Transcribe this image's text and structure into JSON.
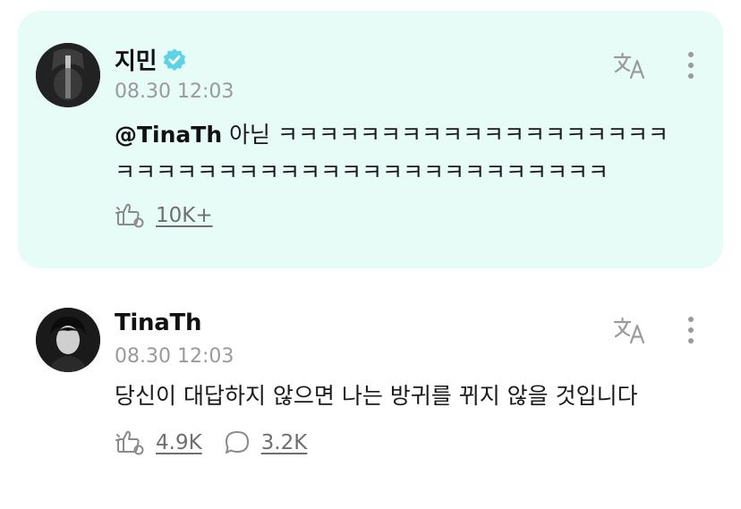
{
  "posts": [
    {
      "author": "지민",
      "verified": true,
      "time": "08.30 12:03",
      "mention": "@TinaTh",
      "text": " 아닏 ㅋㅋㅋㅋㅋㅋㅋㅋㅋㅋㅋㅋㅋㅋㅋㅋㅋㅋㅋㅋㅋㅋㅋㅋㅋㅋㅋㅋㅋㅋㅋㅋㅋㅋㅋㅋㅋㅋㅋㅋㅋㅋㅋ",
      "like_count": "10K+",
      "avatar_icon": "avatar-photo",
      "highlight_color": "#e7fbf7",
      "verified_color": "#5fd3e6"
    },
    {
      "author": "TinaTh",
      "verified": false,
      "time": "08.30 12:03",
      "text": "당신이 대답하지 않으면 나는 방귀를 뀌지 않을 것입니다",
      "like_count": "4.9K",
      "comment_count": "3.2K",
      "avatar_icon": "avatar-photo"
    }
  ],
  "icons": {
    "translate": "translate-icon",
    "more": "more-vertical-icon",
    "like": "like-icon",
    "comment": "comment-icon",
    "verified": "verified-badge-icon"
  }
}
